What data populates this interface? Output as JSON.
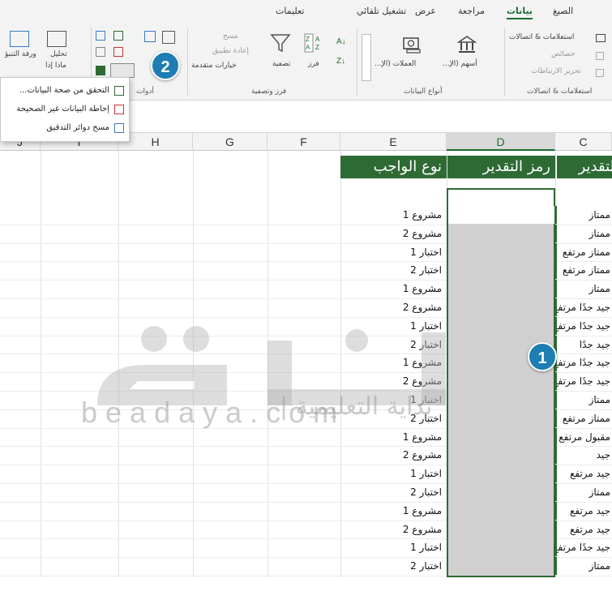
{
  "tabs": {
    "help": "تعليمات",
    "automate": "تشغيل تلقائي",
    "view": "عرض",
    "review": "مراجعة",
    "data": "بيانات",
    "formulas": "الصيغ"
  },
  "ribbon": {
    "queries_connections": {
      "item1": "استعلامات & اتصالات",
      "item2": "خصائص",
      "item3": "تحرير الارتباطات",
      "label": "استعلامات & اتصالات"
    },
    "data_types": {
      "stocks": "أسهم (الإ...",
      "currencies": "العملات (الإ...",
      "label": "أنواع البيانات"
    },
    "sort_filter": {
      "sort": "فرز",
      "filter": "تصفية",
      "clear": "مسح",
      "reapply": "إعادة تطبيق",
      "advanced": "خيارات متقدمة",
      "label": "فرز وتصفية"
    },
    "data_tools": {
      "label": "أدوات"
    },
    "forecast": {
      "what_if": "ماذا إذا",
      "forecast_sheet": "ورقة التنبؤ",
      "analysis": "تحليل"
    }
  },
  "dropdown": {
    "items": [
      "التحقق من صحة البيانات...",
      "إحاطة البيانات غير الصحيحة",
      "مسح دوائر التدقيق"
    ]
  },
  "columns": {
    "letters": [
      "C",
      "D",
      "E",
      "F",
      "G",
      "H",
      "I",
      "J"
    ]
  },
  "headers": {
    "c": "التقدير",
    "d": "رمز التقدير",
    "e": "نوع الواجب"
  },
  "rows_e": [
    "مشروع 1",
    "مشروع 2",
    "اختبار 1",
    "اختبار 2",
    "مشروع 1",
    "مشروع 2",
    "اختبار 1",
    "اختبار 2",
    "مشروع 1",
    "مشروع 2",
    "اختبار 1",
    "اختبار 2",
    "مشروع 1",
    "مشروع 2",
    "اختبار 1",
    "اختبار 2",
    "مشروع 1",
    "مشروع 2",
    "اختبار 1",
    "اختبار 2"
  ],
  "rows_c": [
    "ممتاز",
    "ممتاز",
    "ممتاز مرتفع",
    "ممتاز مرتفع",
    "ممتاز",
    "جيد جدًا مرتفع",
    "جيد جدًا مرتفع",
    "جيد جدًا",
    "جيد جدًا مرتفع",
    "جيد جدًا مرتفع",
    "ممتاز",
    "ممتاز مرتفع",
    "مقبول مرتفع",
    "جيد",
    "جيد مرتفع",
    "ممتاز",
    "جيد مرتفع",
    "جيد مرتفع",
    "جيد جدًا مرتفع",
    "ممتاز"
  ],
  "badges": {
    "one": "1",
    "two": "2"
  },
  "watermark": {
    "latin": "beadaya.com",
    "arabic": "بداية التعليمية |",
    "logo_text": "بداية"
  },
  "colors": {
    "accent": "#2e6b34",
    "badge": "#1e7db2",
    "selection": "#d0d0d0"
  }
}
